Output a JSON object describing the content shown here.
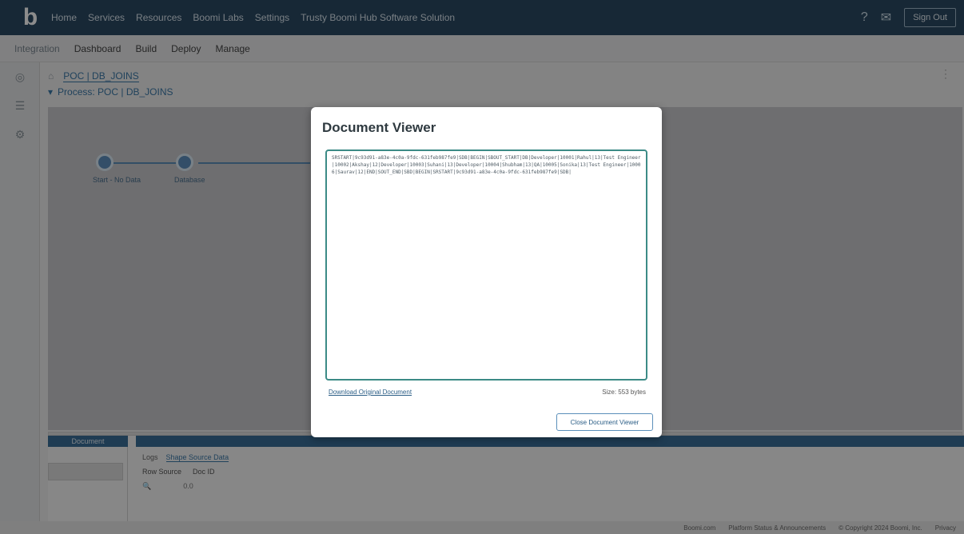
{
  "topbar": {
    "logo": "b",
    "nav": [
      "Home",
      "Services",
      "Resources",
      "Boomi Labs",
      "Settings",
      "Trusty Boomi Hub Software Solution"
    ],
    "sign_out": "Sign Out"
  },
  "subbar": {
    "items": [
      "Integration",
      "Dashboard",
      "Build",
      "Deploy",
      "Manage"
    ]
  },
  "workspace": {
    "tab": "POC | DB_JOINS",
    "process": "Process: POC | DB_JOINS"
  },
  "canvas": {
    "nodes": [
      {
        "label": "Start - No Data"
      },
      {
        "label": "Database"
      }
    ]
  },
  "bottom_panel": {
    "left_header": "Document",
    "tabs": [
      "Logs",
      "Shape Source Data"
    ],
    "cols": [
      "Row Source",
      "Doc ID"
    ],
    "row": [
      "0.0"
    ]
  },
  "footer": {
    "links": [
      "Boomi.com",
      "Platform Status & Announcements",
      "© Copyright 2024 Boomi, Inc.",
      "Privacy"
    ]
  },
  "modal": {
    "title": "Document Viewer",
    "doc_text": "SRSTART|9c93d91-a83e-4c0a-9fdc-631feb987fe9|SDB|BEGIN|SBOUT_START|DB|Developer|10001|Rahul|13|Test Engineer|10002|Akshay|12|Developer|10003|Suhani|13|Developer|10004|Shubham|13|QA|10005|Sonika|13|Test Engineer|10006|Saurav|12|END|SOUT_END|SBD|BEGIN|SRSTART|9c93d91-a83e-4c0a-9fdc-631feb987fe9|SDB|",
    "download": "Download Original Document",
    "size": "Size: 553 bytes",
    "close": "Close Document Viewer"
  }
}
